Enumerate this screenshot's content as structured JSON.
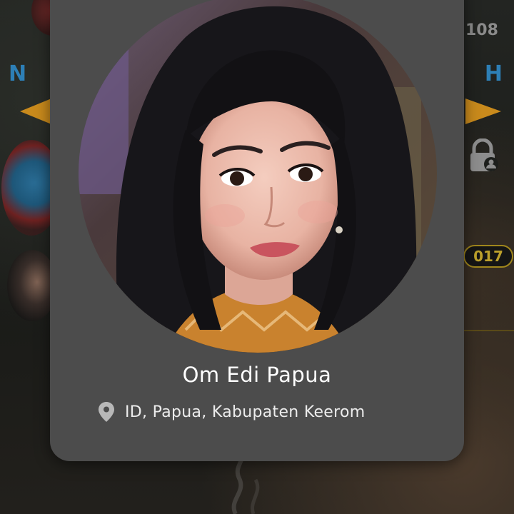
{
  "background": {
    "viewer_count": "108",
    "marquee_left": "N",
    "marquee_right": "I H",
    "room_code": "017"
  },
  "profile": {
    "name": "Om Edi Papua",
    "location": "ID, Papua, Kabupaten Keerom",
    "location_icon": "map-pin-icon",
    "avatar": "profile-photo"
  },
  "colors": {
    "card": "#4c4c4c",
    "name_text": "#ffffff",
    "accent_gold": "#c98a1c",
    "marquee_blue": "#2d7fb6"
  }
}
